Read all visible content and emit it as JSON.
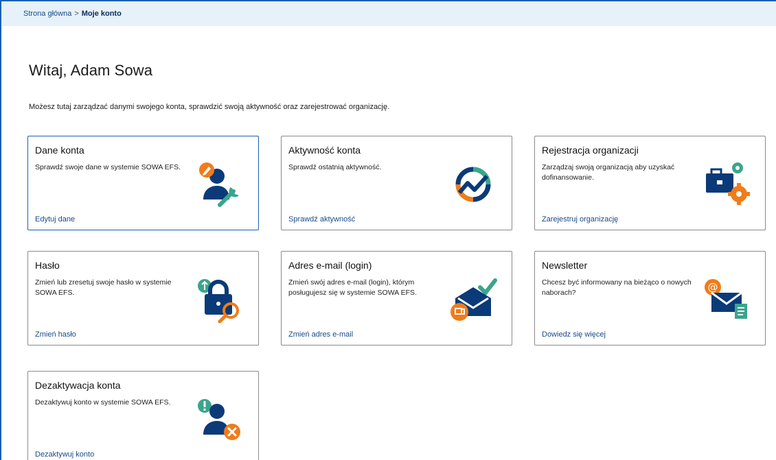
{
  "breadcrumb": {
    "home": "Strona główna",
    "separator": ">",
    "current": "Moje konto"
  },
  "page": {
    "title": "Witaj, Adam Sowa",
    "intro": "Możesz tutaj zarządzać danymi swojego konta, sprawdzić swoją aktywność oraz zarejestrować organizację."
  },
  "colors": {
    "navy": "#0b3a78",
    "orange": "#f07c1a",
    "teal": "#3aa58c",
    "link": "#1a4a8a",
    "breadcrumb_bg": "#e6f1fa"
  },
  "cards": [
    {
      "title": "Dane konta",
      "desc": "Sprawdź swoje dane w systemie SOWA EFS.",
      "link": "Edytuj dane",
      "icon": "user-edit-icon"
    },
    {
      "title": "Aktywność konta",
      "desc": "Sprawdź ostatnią aktywność.",
      "link": "Sprawdź aktywność",
      "icon": "activity-chart-icon"
    },
    {
      "title": "Rejestracja organizacji",
      "desc": "Zarządzaj swoją organizacją aby uzyskać dofinansowanie.",
      "link": "Zarejestruj organizację",
      "icon": "briefcase-gear-icon"
    },
    {
      "title": "Hasło",
      "desc": "Zmień lub zresetuj swoje hasło w systemie SOWA EFS.",
      "link": "Zmień hasło",
      "icon": "padlock-search-icon"
    },
    {
      "title": "Adres e-mail (login)",
      "desc": "Zmień swój adres e-mail (login), którym posługujesz się w systemie SOWA EFS.",
      "link": "Zmień adres e-mail",
      "icon": "envelope-check-icon"
    },
    {
      "title": "Newsletter",
      "desc": "Chcesz być informowany na bieżąco o nowych naborach?",
      "link": "Dowiedz się więcej",
      "icon": "newsletter-envelope-icon"
    },
    {
      "title": "Dezaktywacja konta",
      "desc": "Dezaktywuj konto w systemie SOWA EFS.",
      "link": "Dezaktywuj konto",
      "icon": "user-remove-icon"
    }
  ]
}
